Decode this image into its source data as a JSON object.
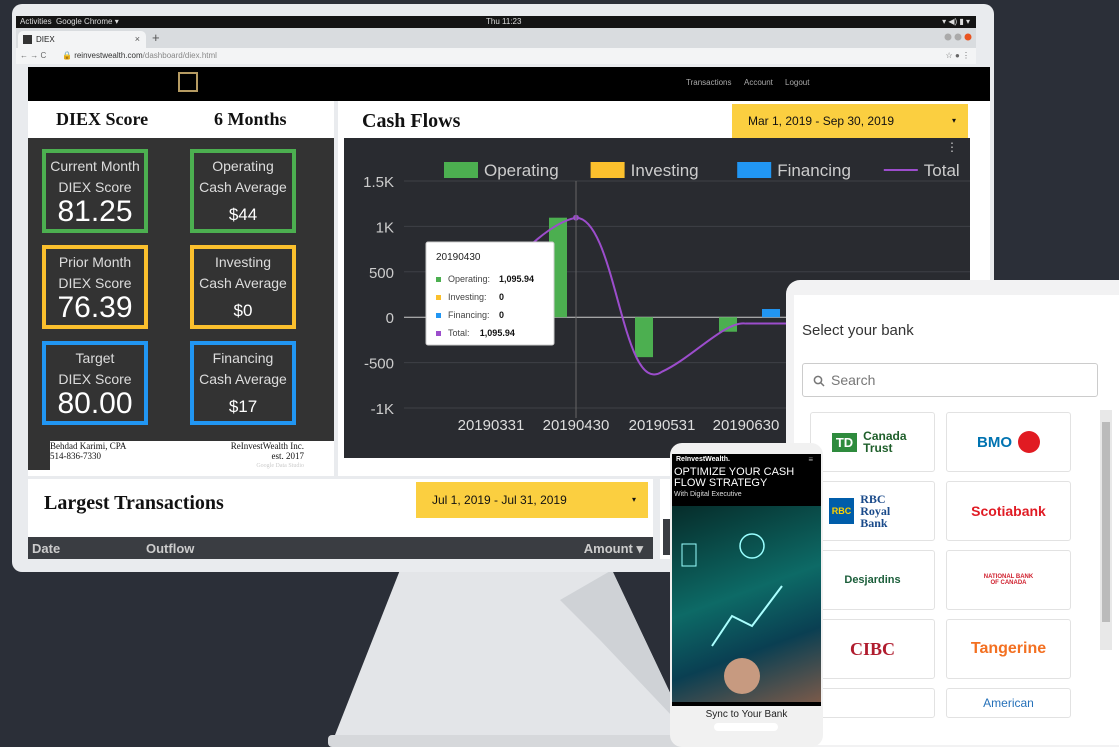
{
  "os": {
    "activities": "Activities",
    "app": "Google Chrome ▾",
    "clock": "Thu 11:23",
    "tray": "▾ ◀) ▮ ▾"
  },
  "browser": {
    "tab_title": "DIEX",
    "tab_close": "×",
    "new_tab": "+",
    "nav": "← → C",
    "url_main": "reinvestwealth.com",
    "url_path": "/dashboard/diex.html",
    "actions": "☆ ● ⋮"
  },
  "header": {
    "links": [
      "Transactions",
      "Account",
      "Logout"
    ]
  },
  "left": {
    "title1": "DIEX Score",
    "title2": "6 Months",
    "cards": [
      {
        "l1": "Current Month",
        "l2": "DIEX Score",
        "value": "81.25",
        "color": "#4caf50"
      },
      {
        "l1": "Operating",
        "l2": "Cash Average",
        "value": "$44",
        "color": "#4caf50"
      },
      {
        "l1": "Prior Month",
        "l2": "DIEX Score",
        "value": "76.39",
        "color": "#fbc02d"
      },
      {
        "l1": "Investing",
        "l2": "Cash Average",
        "value": "$0",
        "color": "#fbc02d"
      },
      {
        "l1": "Target",
        "l2": "DIEX Score",
        "value": "80.00",
        "color": "#2196f3"
      },
      {
        "l1": "Financing",
        "l2": "Cash Average",
        "value": "$17",
        "color": "#2196f3"
      }
    ],
    "footer_name": "Behdad Karimi, CPA",
    "footer_phone": "514-836-7330",
    "footer_co": "ReInvestWealth Inc.",
    "footer_est": "est. 2017",
    "footer_gds": "Google Data Studio"
  },
  "cashflows": {
    "title": "Cash Flows",
    "date_range": "Mar 1, 2019 - Sep 30, 2019",
    "dropdown": "▾",
    "menu": "⋮"
  },
  "chart_data": {
    "type": "bar",
    "categories": [
      "20190331",
      "20190430",
      "20190531",
      "20190630"
    ],
    "series": [
      {
        "name": "Operating",
        "color": "#4caf50",
        "values": [
          0,
          1095.94,
          -440,
          -160
        ]
      },
      {
        "name": "Investing",
        "color": "#fbc02d",
        "values": [
          0,
          0,
          0,
          0
        ]
      },
      {
        "name": "Financing",
        "color": "#2196f3",
        "values": [
          0,
          0,
          0,
          90
        ]
      },
      {
        "name": "Total",
        "color": "#9c4dcc",
        "type": "line",
        "values": [
          750,
          1095.94,
          -440,
          -70
        ]
      }
    ],
    "yticks": [
      "1.5K",
      "1K",
      "500",
      "0",
      "-500",
      "-1K"
    ],
    "ylim": [
      -1000,
      1500
    ],
    "legend": "top",
    "tooltip": {
      "title": "20190430",
      "rows": [
        {
          "label": "Operating:",
          "value": "1,095.94",
          "color": "#4caf50"
        },
        {
          "label": "Investing:",
          "value": "0",
          "color": "#fbc02d"
        },
        {
          "label": "Financing:",
          "value": "0",
          "color": "#2196f3"
        },
        {
          "label": "Total:",
          "value": "1,095.94",
          "color": "#9c4dcc"
        }
      ]
    }
  },
  "transactions": {
    "title": "Largest Transactions",
    "date_range": "Jul 1, 2019 - Jul 31, 2019",
    "dropdown": "▾",
    "col_date": "Date",
    "col_outflow": "Outflow",
    "col_amount": "Amount ▾"
  },
  "tablet": {
    "title": "Select your bank",
    "search_placeholder": "Search",
    "banks": [
      "Canada Trust",
      "BMO",
      "RBC Royal Bank",
      "Scotiabank",
      "Desjardins",
      "NATIONAL BANK OF CANADA",
      "CIBC",
      "Tangerine",
      "American"
    ],
    "td": "TD",
    "rbc": "RBC"
  },
  "phone": {
    "brand": "ReInvestWealth.",
    "headline1": "OPTIMIZE YOUR CASH",
    "headline2": "FLOW STRATEGY",
    "sub": "With Digital Executive",
    "cta": "Sync to Your Bank"
  }
}
